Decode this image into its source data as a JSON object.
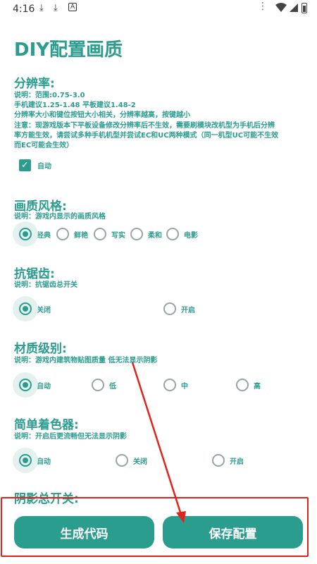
{
  "status_bar": {
    "time": "4:16",
    "icons": [
      "download-icon",
      "download-icon",
      "font-icon",
      "wifi-icon",
      "signal-icon",
      "battery-icon"
    ]
  },
  "title": "DIY配置画质",
  "resolution": {
    "title": "分辨率:",
    "desc": [
      "说明：范围:0.75-3.0",
      "手机建议1.25-1.48  平板建议1.48-2",
      "分辨率大小和键位按钮大小相关，分辨率越高，按键越小",
      "注意：现游戏版本下平板设备修改分辨率后不生效，需要刷模块改机型为手机后分辨",
      "率方能生效，请尝试多种手机机型并尝试EC和UC两种模式（同一机型UC可能不生效",
      "而EC可能会生效）"
    ],
    "auto_label": "自动",
    "auto_checked": true
  },
  "style": {
    "title": "画质风格:",
    "desc": "说明：游戏内显示的画质风格",
    "options": [
      "经典",
      "鲜艳",
      "写实",
      "柔和",
      "电影"
    ],
    "selected": "经典"
  },
  "antialias": {
    "title": "抗锯齿:",
    "desc": "说明：抗锯齿总开关",
    "options": [
      "关闭",
      "开启"
    ],
    "selected": "关闭"
  },
  "texture": {
    "title": "材质级别:",
    "desc": "说明：游戏内建筑物贴图质量 低无法显示阴影",
    "options": [
      "自动",
      "低",
      "中",
      "高"
    ],
    "selected": "自动"
  },
  "shader": {
    "title": "简单着色器:",
    "desc": "说明：开启后更流畅但无法显示阴影",
    "options": [
      "自动",
      "关闭",
      "开启"
    ],
    "selected": "自动"
  },
  "shadow": {
    "title": "阴影总开关:"
  },
  "buttons": {
    "generate": "生成代码",
    "save": "保存配置"
  },
  "colors": {
    "accent": "#2a9d8f",
    "highlight": "#e0231c"
  }
}
